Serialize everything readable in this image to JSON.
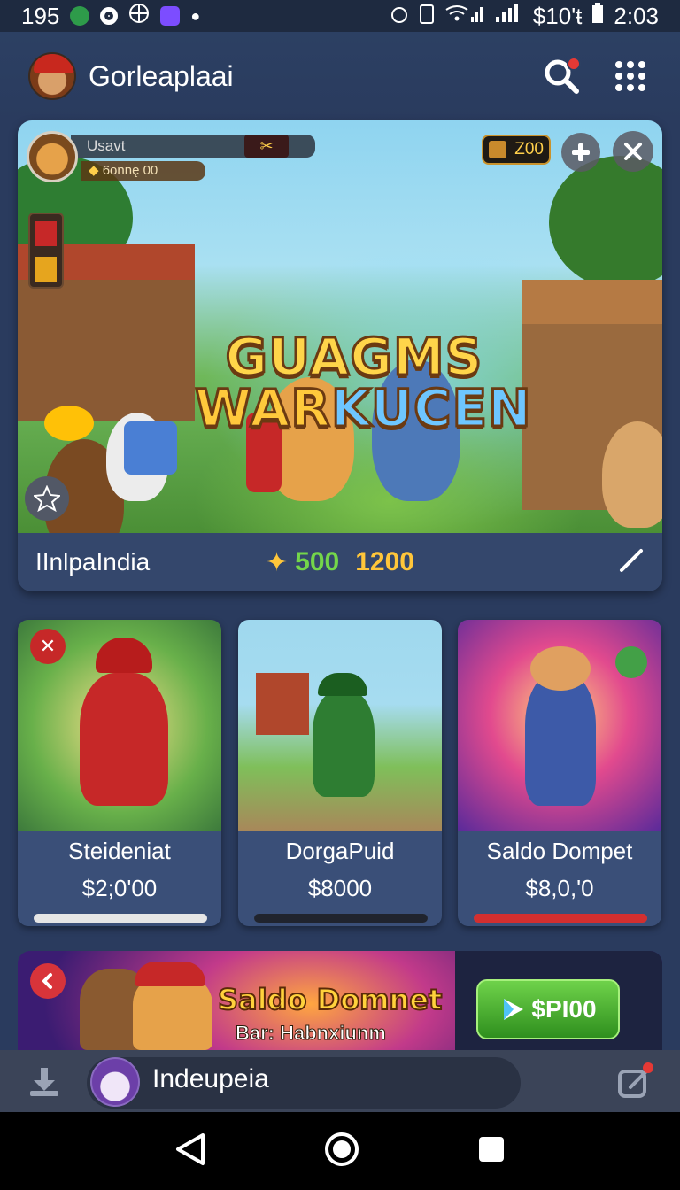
{
  "status_bar": {
    "left_text": "195",
    "right_text": "$10'ŧ",
    "time": "2:03"
  },
  "app_bar": {
    "title": "Gorleaplaai",
    "icons": [
      "app-logo-icon",
      "search-icon",
      "grid-menu-icon"
    ]
  },
  "hero": {
    "title_line1": "GUAGMS",
    "title_line2_a": "WAR",
    "title_line2_b": "KU",
    "title_line2_c": "CEN",
    "user_name": "Usavt",
    "user_coins": "6onnę 00",
    "coin_chip": "Z00",
    "footer_name": "IInlpaIndia",
    "footer_value_green": "500",
    "footer_value_gold": "1200"
  },
  "cards": [
    {
      "name": "Steideniat",
      "price": "$2;0'00",
      "bar_color": "#e6e6e6",
      "bar_fill": 1.0
    },
    {
      "name": "DorgaPuid",
      "price": "$8000",
      "bar_color": "#20242e",
      "bar_fill": 1.0
    },
    {
      "name": "Saldo Dompet",
      "price": "$8,0,'0",
      "bar_color": "#d32f2f",
      "bar_fill": 1.0
    }
  ],
  "promo": {
    "headline": "Saldo Domnet",
    "subtitle": "Bar: Habnxiunm",
    "buy_label": "$PI00"
  },
  "bottom_bar": {
    "label": "Indeupeia"
  },
  "colors": {
    "background": "#2a3b5e",
    "accent_green": "#74d64a",
    "accent_gold": "#ffc63a",
    "notification_red": "#e53935"
  }
}
